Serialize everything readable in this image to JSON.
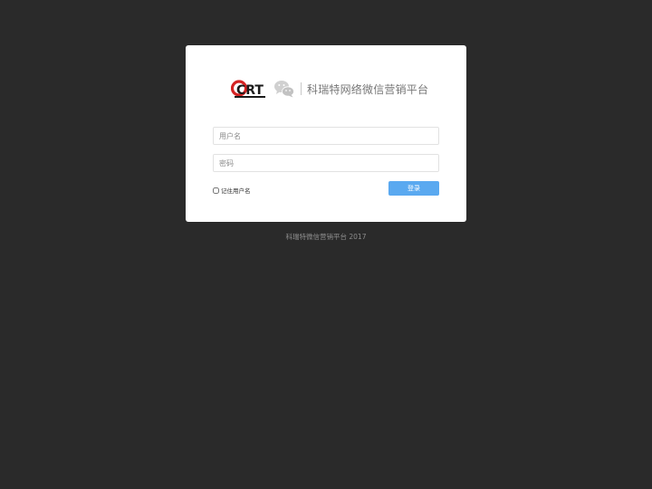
{
  "brand": {
    "logo_text": "CRT",
    "name": "科瑞特网络微信营销平台",
    "logo_colors": {
      "red": "#d32222",
      "black": "#1a1a1a"
    }
  },
  "login": {
    "username_placeholder": "用户名",
    "password_placeholder": "密码",
    "remember_label": "记住用户名",
    "remember_checked": false,
    "submit_label": "登录"
  },
  "footer": {
    "text": "科瑞特微信营销平台 2017"
  },
  "colors": {
    "page_background": "#2a2a2a",
    "card_background": "#ffffff",
    "primary_button": "#5aa9f0"
  },
  "icons": [
    "crt-logo",
    "wechat-icon"
  ]
}
